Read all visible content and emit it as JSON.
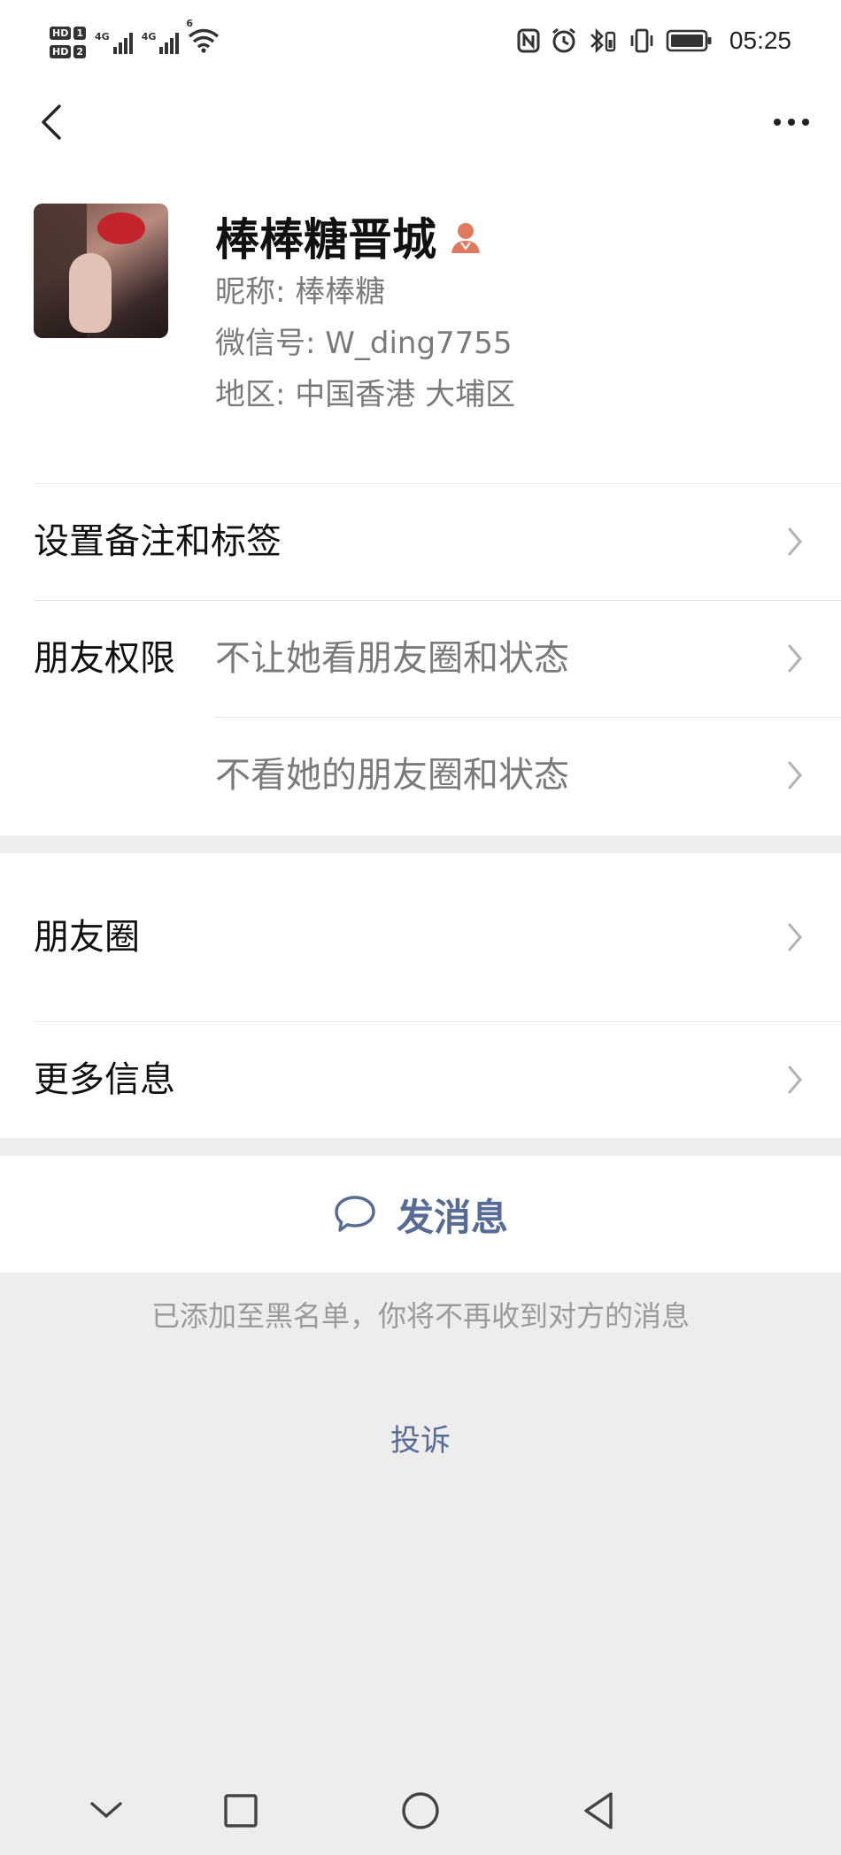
{
  "status_bar": {
    "sim1": "HD",
    "sim1_slot": "1",
    "sim2": "HD",
    "sim2_slot": "2",
    "net1": "4G",
    "net2": "4G",
    "wifi_badge": "6",
    "time": "05:25",
    "icons": [
      "nfc-icon",
      "alarm-icon",
      "bluetooth-icon",
      "vibrate-icon",
      "battery-icon"
    ]
  },
  "profile": {
    "name": "棒棒糖晋城",
    "nickname": "昵称:  棒棒糖",
    "wechat_id": "微信号:  W_ding7755",
    "region": "地区:  中国香港  大埔区",
    "gender_icon_color": "#e07a5f"
  },
  "menu": {
    "remark_tags": "设置备注和标签",
    "friend_permissions_label": "朋友权限",
    "permission_1": "不让她看朋友圈和状态",
    "permission_2": "不看她的朋友圈和状态",
    "moments": "朋友圈",
    "more_info": "更多信息"
  },
  "actions": {
    "send_message": "发消息",
    "accent_color": "#576b95"
  },
  "notice": "已添加至黑名单，你将不再收到对方的消息",
  "complain": "投诉"
}
